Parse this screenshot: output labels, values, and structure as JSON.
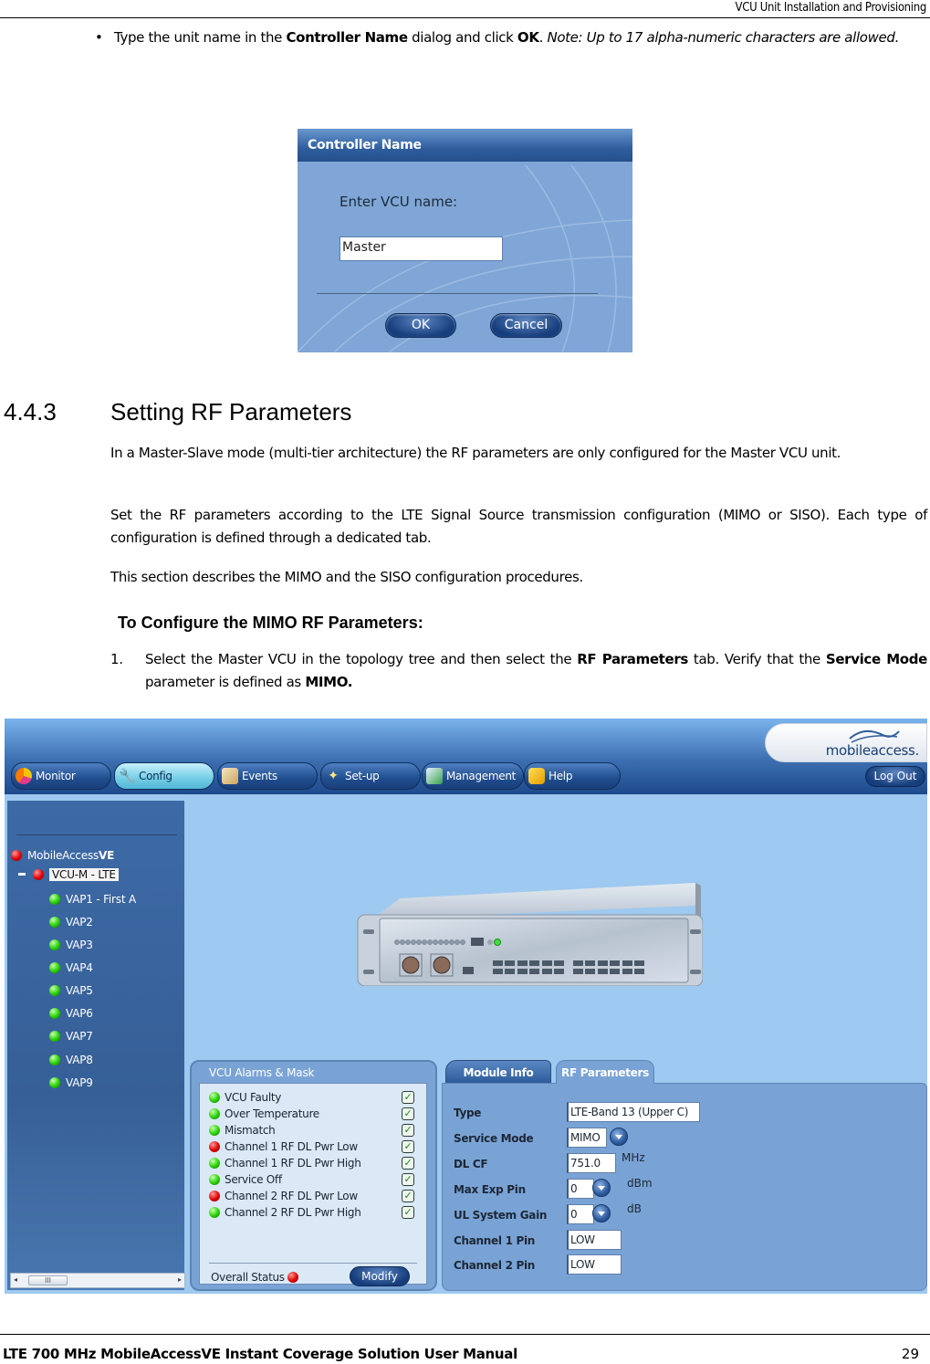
{
  "page": {
    "header": "VCU Unit Installation and Provisioning",
    "footer_title": "LTE 700 MHz MobileAccessVE Instant Coverage Solution User Manual",
    "page_number": "29"
  },
  "bullet": {
    "symbol": "•",
    "part1": "Type the unit name in the ",
    "bold1": "Controller Name",
    "part2": " dialog and click ",
    "bold2": "OK",
    "part3": ". ",
    "note": "Note: Up to 17 alpha-numeric characters are allowed."
  },
  "dialog": {
    "title": "Controller Name",
    "label": "Enter VCU name:",
    "input_value": "Master",
    "ok_label": "OK",
    "cancel_label": "Cancel"
  },
  "section": {
    "number": "4.4.3",
    "title": "Setting RF Parameters",
    "para1": "In a Master-Slave mode (multi-tier architecture) the RF parameters are only configured for the Master VCU unit.",
    "para2": "Set the RF parameters according to the LTE Signal Source transmission configuration (MIMO or SISO). Each type of configuration is defined through a dedicated tab.",
    "para3": "This section describes the MIMO and the SISO configuration procedures.",
    "procedure_title": "To Configure the MIMO RF Parameters:",
    "step1": {
      "number": "1.",
      "part1": "Select the Master VCU in the topology tree and then select the ",
      "bold1": "RF Parameters",
      "part2": " tab. Verify that the ",
      "bold2": "Service Mode",
      "part3": " parameter is defined as ",
      "bold3": "MIMO."
    }
  },
  "app": {
    "logo_text": "mobileaccess.",
    "nav_tabs": [
      {
        "label": "Monitor",
        "icon": "monitor-icon",
        "active": false
      },
      {
        "label": "Config",
        "icon": "wrench-icon",
        "active": true
      },
      {
        "label": "Events",
        "icon": "events-icon",
        "active": false
      },
      {
        "label": "Set-up",
        "icon": "wand-icon",
        "active": false
      },
      {
        "label": "Management",
        "icon": "management-icon",
        "active": false
      },
      {
        "label": "Help",
        "icon": "help-book-icon",
        "active": false
      }
    ],
    "logout_label": "Log Out",
    "tree": {
      "root_prefix": "MobileAccess",
      "root_suffix": "VE",
      "root_status": "red",
      "vcu": {
        "label": "VCU-M - LTE",
        "status": "red",
        "selected": true
      },
      "vaps": [
        {
          "label": "VAP1 - First A",
          "status": "green"
        },
        {
          "label": "VAP2",
          "status": "green"
        },
        {
          "label": "VAP3",
          "status": "green"
        },
        {
          "label": "VAP4",
          "status": "green"
        },
        {
          "label": "VAP5",
          "status": "green"
        },
        {
          "label": "VAP6",
          "status": "green"
        },
        {
          "label": "VAP7",
          "status": "green"
        },
        {
          "label": "VAP8",
          "status": "green"
        },
        {
          "label": "VAP9",
          "status": "green"
        }
      ],
      "scroll_thumb": "III"
    },
    "alarms": {
      "title": "VCU Alarms & Mask",
      "items": [
        {
          "label": "VCU Faulty",
          "status": "green",
          "masked": true
        },
        {
          "label": "Over Temperature",
          "status": "green",
          "masked": true
        },
        {
          "label": "Mismatch",
          "status": "green",
          "masked": true
        },
        {
          "label": "Channel 1 RF DL Pwr Low",
          "status": "red",
          "masked": true
        },
        {
          "label": "Channel 1 RF DL Pwr High",
          "status": "green",
          "masked": true
        },
        {
          "label": "Service Off",
          "status": "green",
          "masked": true
        },
        {
          "label": "Channel 2 RF DL Pwr Low",
          "status": "red",
          "masked": true
        },
        {
          "label": "Channel 2 RF DL Pwr High",
          "status": "green",
          "masked": true
        }
      ],
      "check_glyph": "✓",
      "overall_label": "Overall Status",
      "overall_status": "red",
      "modify_label": "Modify"
    },
    "tabs": {
      "module_info": "Module Info",
      "rf_parameters": "RF Parameters"
    },
    "rf": {
      "type_label": "Type",
      "type_value": "LTE-Band 13 (Upper C)",
      "service_mode_label": "Service Mode",
      "service_mode_value": "MIMO",
      "dl_cf_label": "DL CF",
      "dl_cf_value": "751.0",
      "dl_cf_unit": "MHz",
      "max_exp_pin_label": "Max Exp Pin",
      "max_exp_pin_value": "0",
      "max_exp_pin_unit": "dBm",
      "ul_gain_label": "UL System Gain",
      "ul_gain_value": "0",
      "ul_gain_unit": "dB",
      "ch1_pin_label": "Channel 1 Pin",
      "ch1_pin_value": "LOW",
      "ch2_pin_label": "Channel 2 Pin",
      "ch2_pin_value": "LOW"
    }
  }
}
